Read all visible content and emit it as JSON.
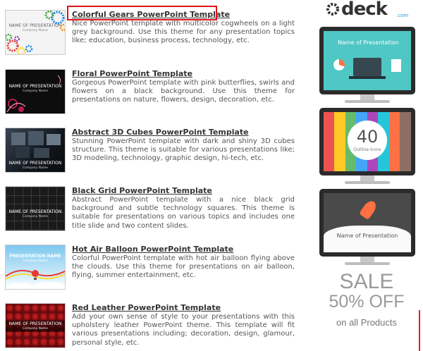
{
  "templates": [
    {
      "title": "Colorful Gears PowerPoint Template",
      "description": "Nice PowerPoint template with multicolor cogwheels on a light grey background. Use this theme for any presentation topics like; education, business process, technology, etc.",
      "thumb_title": "NAME OF PRESENTATION",
      "thumb_sub": "Company Name"
    },
    {
      "title": "Floral PowerPoint Template",
      "description": "Gorgeous PowerPoint template with pink butterflies, swirls and flowers on a black background. Use this theme for presentations on nature, flowers, design, decoration, etc.",
      "thumb_title": "NAME OF PRESENTATION",
      "thumb_sub": "Company Name"
    },
    {
      "title": "Abstract 3D Cubes PowerPoint Template",
      "description": "Stunning PowerPoint template with dark and shiny 3D cubes structure. This theme is suitable for various presentations like; 3D modeling, technology, graphic design, hi-tech, etc.",
      "thumb_title": "NAME OF PRESENTATION",
      "thumb_sub": "Company Name"
    },
    {
      "title": "Black Grid PowerPoint Template",
      "description": "Abstract PowerPoint template with a nice black grid background and subtle technology squares. This theme is suitable for presentations on various topics and includes one title slide and two content slides.",
      "thumb_title": "NAME OF PRESENTATION",
      "thumb_sub": "Company Name"
    },
    {
      "title": "Hot Air Balloon PowerPoint Template",
      "description": "Colorful PowerPoint template with hot air balloon flying above the clouds. Use this theme for presentations on air balloon, flying, summer entertainment, etc.",
      "thumb_title": "PRESENTATION NAME",
      "thumb_sub": "Company Name"
    },
    {
      "title": "Red Leather PowerPoint Template",
      "description": "Add your own sense of style to your presentations with this upholstery leather PowerPoint theme. This template will fit various presentations including; decoration, design, glamour, personal style, etc.",
      "thumb_title": "NAME OF PRESENTATION",
      "thumb_sub": "Company Name"
    }
  ],
  "ad": {
    "logo_text": "deck",
    "logo_suffix": ".com",
    "monitor1_title": "Name of Presentation",
    "monitor2_number": "40",
    "monitor2_label": "Outline Icons",
    "monitor3_title": "Name of Presentation",
    "sale_line1": "SALE",
    "sale_line2": "50% OFF",
    "sale_line3": "on all Products"
  },
  "colors": {
    "highlight": "#e0131a",
    "logo_accent": "#2a9bd4",
    "slide_teal": "#4fc7c4"
  }
}
